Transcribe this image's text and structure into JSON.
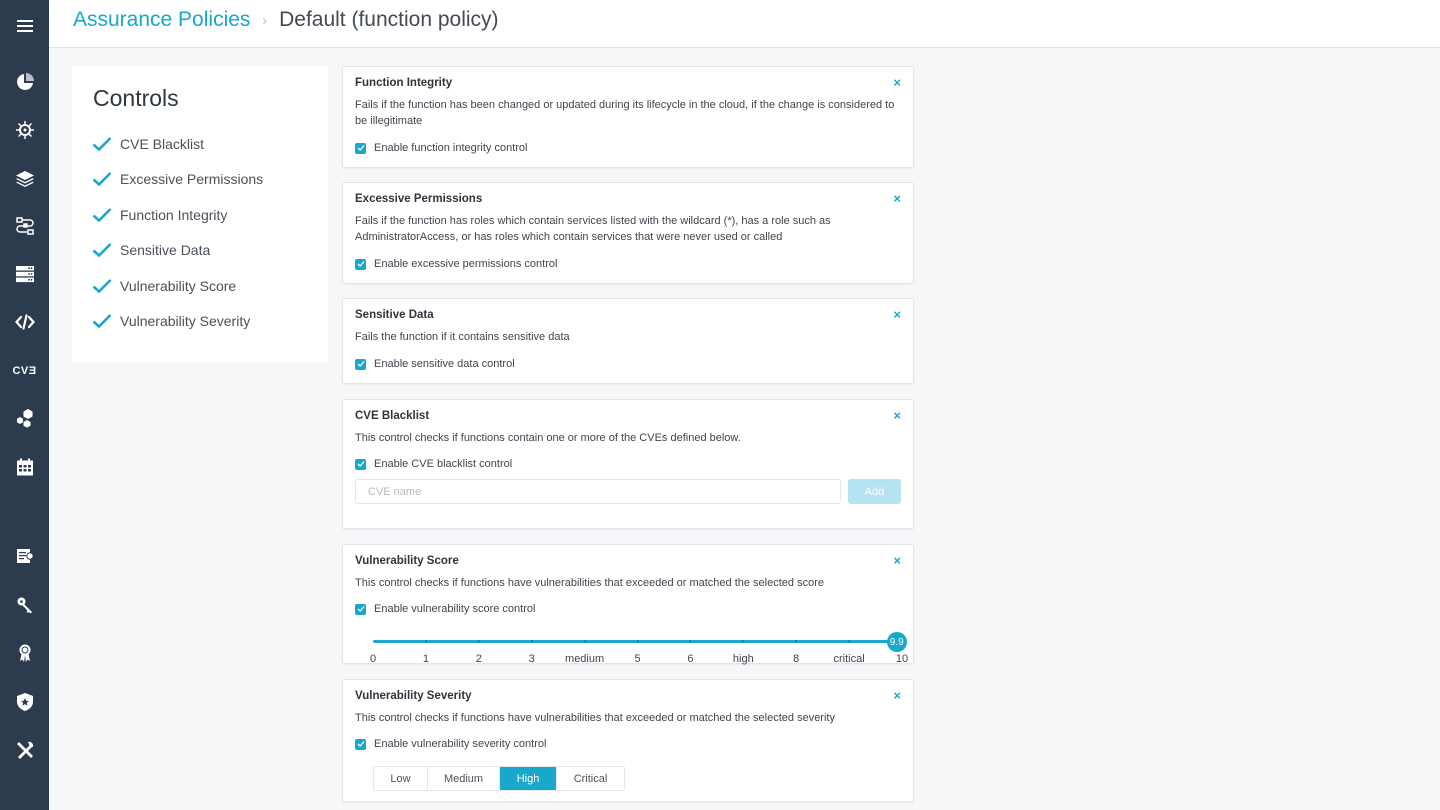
{
  "breadcrumb": {
    "parent": "Assurance Policies",
    "separator": "›",
    "current": "Default (function policy)"
  },
  "sidebar": {
    "icons": [
      {
        "name": "menu-icon"
      },
      {
        "name": "dashboard-pie-icon"
      },
      {
        "name": "kubernetes-helm-icon"
      },
      {
        "name": "layers-icon"
      },
      {
        "name": "workflow-icon"
      },
      {
        "name": "servers-icon"
      },
      {
        "name": "code-icon"
      },
      {
        "name": "cve-icon",
        "text": "CVƎ"
      },
      {
        "name": "hexagons-icon"
      },
      {
        "name": "calendar-icon"
      },
      {
        "name": "audit-report-icon"
      },
      {
        "name": "key-icon"
      },
      {
        "name": "award-badge-icon"
      },
      {
        "name": "shield-star-icon"
      },
      {
        "name": "tools-icon"
      }
    ]
  },
  "controls": {
    "title": "Controls",
    "items": [
      {
        "label": "CVE Blacklist"
      },
      {
        "label": "Excessive Permissions"
      },
      {
        "label": "Function Integrity"
      },
      {
        "label": "Sensitive Data"
      },
      {
        "label": "Vulnerability Score"
      },
      {
        "label": "Vulnerability Severity"
      }
    ]
  },
  "cards": {
    "function_integrity": {
      "title": "Function Integrity",
      "description": "Fails if the function has been changed or updated during its lifecycle in the cloud, if the change is considered to be illegitimate",
      "checkbox_label": "Enable function integrity control",
      "checked": true,
      "close": "×"
    },
    "excessive_permissions": {
      "title": "Excessive Permissions",
      "description": "Fails if the function has roles which contain services listed with the wildcard (*), has a role such as AdministratorAccess, or has roles which contain services that were never used or called",
      "checkbox_label": "Enable excessive permissions control",
      "checked": true,
      "close": "×"
    },
    "sensitive_data": {
      "title": "Sensitive Data",
      "description": "Fails the function if it contains sensitive data",
      "checkbox_label": "Enable sensitive data control",
      "checked": true,
      "close": "×"
    },
    "cve_blacklist": {
      "title": "CVE Blacklist",
      "description": "This control checks if functions contain one or more of the CVEs defined below.",
      "checkbox_label": "Enable CVE blacklist control",
      "checked": true,
      "close": "×",
      "input_placeholder": "CVE name",
      "input_value": "",
      "add_label": "Add"
    },
    "vulnerability_score": {
      "title": "Vulnerability Score",
      "description": "This control checks if functions have vulnerabilities that exceeded or matched the selected score",
      "checkbox_label": "Enable vulnerability score control",
      "checked": true,
      "close": "×",
      "slider": {
        "min": 0,
        "max": 10,
        "value": 9.9,
        "value_label": "9.9",
        "labels": [
          "0",
          "1",
          "2",
          "3",
          "medium",
          "5",
          "6",
          "high",
          "8",
          "critical",
          "10"
        ]
      }
    },
    "vulnerability_severity": {
      "title": "Vulnerability Severity",
      "description": "This control checks if functions have vulnerabilities that exceeded or matched the selected severity",
      "checkbox_label": "Enable vulnerability severity control",
      "checked": true,
      "close": "×",
      "options": [
        "Low",
        "Medium",
        "High",
        "Critical"
      ],
      "selected": "High"
    }
  },
  "colors": {
    "accent": "#1aa7cc",
    "sidebar_bg": "#2c3b4e",
    "add_disabled": "#b5e3f1"
  }
}
